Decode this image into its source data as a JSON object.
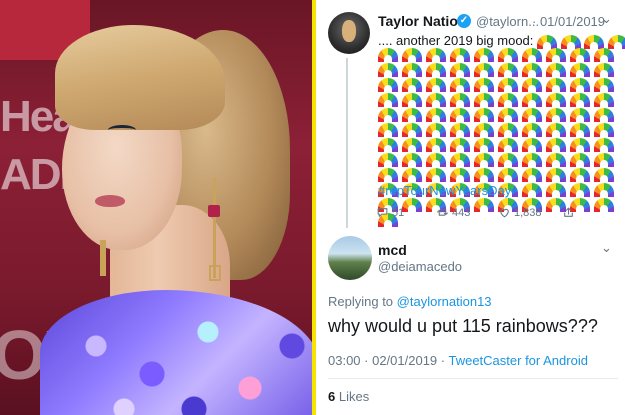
{
  "photo": {
    "background_text": [
      "Hea",
      "ADI",
      "OX"
    ]
  },
  "tweet1": {
    "name": "Taylor Nation",
    "handle": "@taylorn...",
    "date": "· 01/01/2019",
    "text": ".... another 2019 big mood:",
    "rainbow_emoji": "🌈",
    "rainbow_count": 115,
    "hashtag": "#repTourNewYearsDay",
    "actions": {
      "replies": "51",
      "retweets": "443",
      "likes": "1,838"
    }
  },
  "tweet2": {
    "name": "mcd",
    "handle": "@deiamacedo",
    "reply_prefix": "Replying to",
    "reply_to": "@taylornation13",
    "text": "why would u put 115 rainbows???",
    "time": "03:00 · 02/01/2019 ·",
    "client": "TweetCaster for Android",
    "likes_count": "6",
    "likes_label": "Likes"
  },
  "colors": {
    "link": "#1b95e0",
    "muted": "#657786",
    "divider": "#f5e400",
    "verified": "#1da1f2"
  },
  "icons": [
    "verified-icon",
    "chevron-down-icon",
    "reply-icon",
    "retweet-icon",
    "like-icon",
    "share-icon"
  ]
}
